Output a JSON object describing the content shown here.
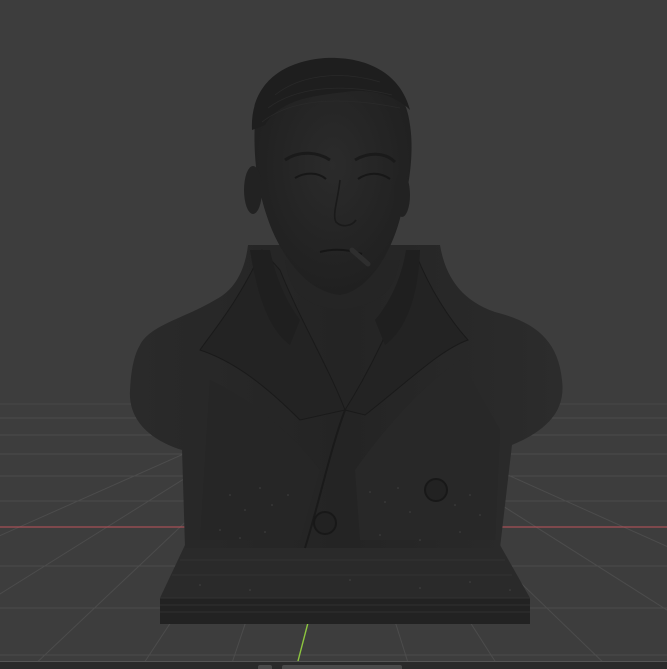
{
  "viewport": {
    "background_color": "#3d3d3d",
    "grid_color": "#4a4a4a",
    "x_axis_color": "#b8525a",
    "y_axis_color": "#8dc63f",
    "model_color": "#262626"
  },
  "scene": {
    "object": "bust",
    "icons": [
      "bust-model-icon"
    ]
  }
}
